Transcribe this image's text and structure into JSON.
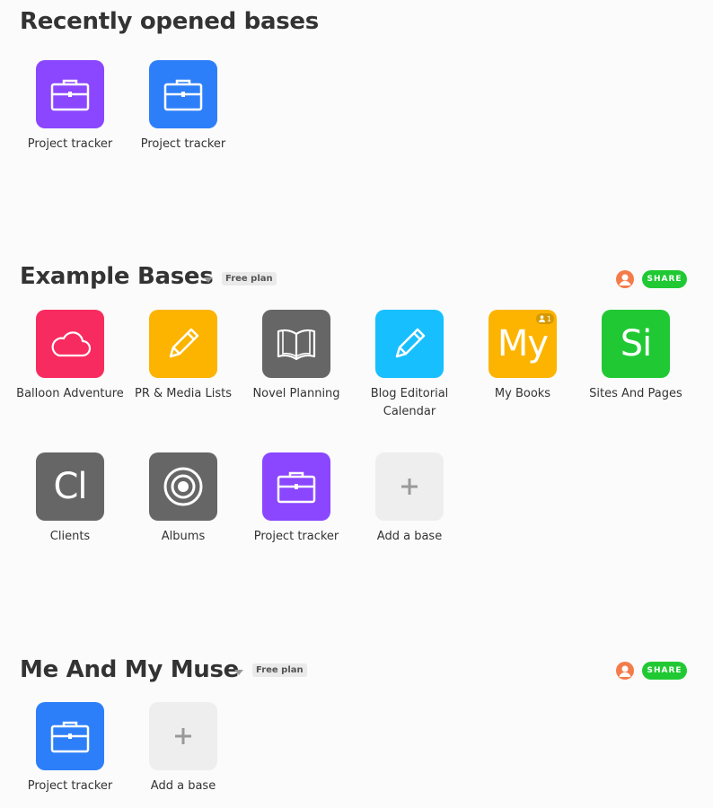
{
  "recent": {
    "title": "Recently opened bases",
    "bases": [
      {
        "label": "Project tracker",
        "color": "#8b46ff",
        "icon": "briefcase-icon"
      },
      {
        "label": "Project tracker",
        "color": "#2d7ff9",
        "icon": "briefcase-icon"
      }
    ]
  },
  "workspaces": [
    {
      "title": "Example Bases",
      "plan": "Free plan",
      "share_label": "SHARE",
      "bases": [
        {
          "label": "Balloon Adventure",
          "color": "#f82b60",
          "icon": "cloud-icon"
        },
        {
          "label": "PR & Media Lists",
          "color": "#fcb400",
          "icon": "pencil-icon"
        },
        {
          "label": "Novel Planning",
          "color": "#666666",
          "icon": "book-icon"
        },
        {
          "label": "Blog Editorial Calendar",
          "color": "#18bfff",
          "icon": "pencil-icon"
        },
        {
          "label": "My Books",
          "color": "#fcb400",
          "icon": "initials",
          "initials": "My",
          "collaborators": "1"
        },
        {
          "label": "Sites And Pages",
          "color": "#20c933",
          "icon": "initials",
          "initials": "Si"
        },
        {
          "label": "Clients",
          "color": "#666666",
          "icon": "initials",
          "initials": "Cl"
        },
        {
          "label": "Albums",
          "color": "#666666",
          "icon": "record-icon"
        },
        {
          "label": "Project tracker",
          "color": "#8b46ff",
          "icon": "briefcase-icon"
        }
      ],
      "add_label": "Add a base"
    },
    {
      "title": "Me And My Muse",
      "plan": "Free plan",
      "share_label": "SHARE",
      "bases": [
        {
          "label": "Project tracker",
          "color": "#2d7ff9",
          "icon": "briefcase-icon"
        }
      ],
      "add_label": "Add a base"
    }
  ]
}
